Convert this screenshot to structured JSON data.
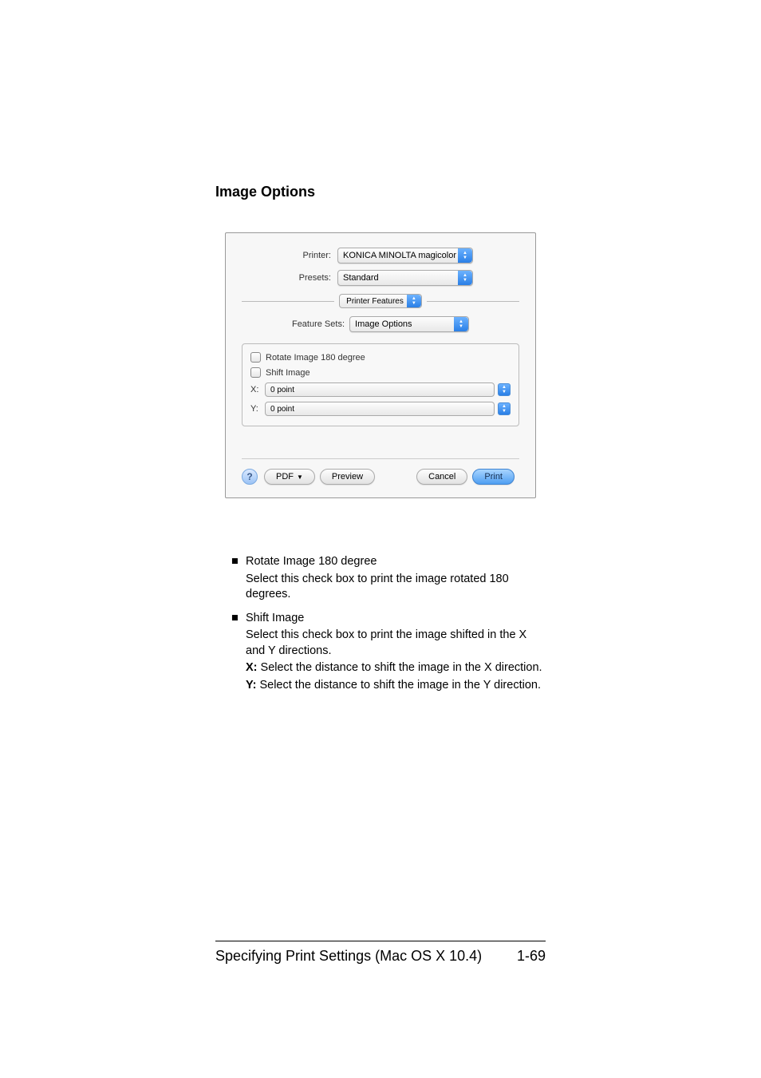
{
  "heading": "Image Options",
  "dialog": {
    "labels": {
      "printer": "Printer:",
      "presets": "Presets:",
      "feature_sets": "Feature Sets:"
    },
    "printer_value": "KONICA MINOLTA magicolor ...",
    "presets_value": "Standard",
    "pane_value": "Printer Features",
    "featureset_value": "Image Options",
    "checks": {
      "rotate": "Rotate Image 180 degree",
      "shift": "Shift Image"
    },
    "xy": {
      "x_label": "X:",
      "y_label": "Y:",
      "x_value": "0 point",
      "y_value": "0 point"
    },
    "buttons": {
      "help": "?",
      "pdf": "PDF",
      "preview": "Preview",
      "cancel": "Cancel",
      "print": "Print"
    }
  },
  "bullets": {
    "rotate": {
      "title": "Rotate Image 180 degree",
      "desc": "Select this check box to print the image rotated 180 degrees."
    },
    "shift": {
      "title": "Shift Image",
      "desc": "Select this check box to print the image shifted in the X and Y directions.",
      "x_bold": "X:",
      "x_text": " Select the distance to shift the image in the X direction.",
      "y_bold": "Y:",
      "y_text": " Select the distance to shift the image in the Y direction."
    }
  },
  "footer": {
    "left": "Specifying Print Settings (Mac OS X 10.4)",
    "right": "1-69"
  }
}
